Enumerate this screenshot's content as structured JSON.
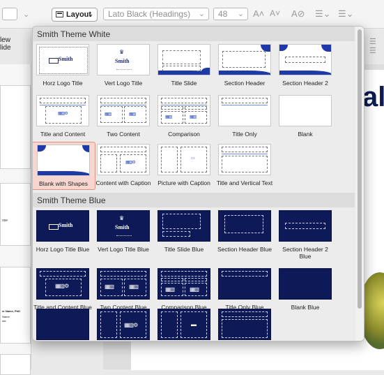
{
  "toolbar": {
    "font_name": "Lato Black (Headings)",
    "font_size": "48",
    "layout_label": "Layout",
    "new_slide_label": "New\nSlide"
  },
  "background": {
    "big_text": "al",
    "left_pane_texts": [
      "ose",
      "er Name, PhD",
      "Name",
      "ute"
    ]
  },
  "popup": {
    "sections": [
      {
        "name": "Smith Theme White",
        "layouts": [
          {
            "label": "Horz Logo Title",
            "icon": "horz-logo-title-thumb"
          },
          {
            "label": "Vert Logo Title",
            "icon": "vert-logo-title-thumb"
          },
          {
            "label": "Title Slide",
            "icon": "title-slide-thumb"
          },
          {
            "label": "Section Header",
            "icon": "section-header-thumb"
          },
          {
            "label": "Section Header 2",
            "icon": "section-header-2-thumb"
          },
          {
            "label": "Title and Content",
            "icon": "title-content-thumb"
          },
          {
            "label": "Two Content",
            "icon": "two-content-thumb"
          },
          {
            "label": "Comparison",
            "icon": "comparison-thumb"
          },
          {
            "label": "Title Only",
            "icon": "title-only-thumb"
          },
          {
            "label": "Blank",
            "icon": "blank-thumb"
          },
          {
            "label": "Blank with Shapes",
            "icon": "blank-shapes-thumb",
            "selected": true
          },
          {
            "label": "Content with Caption",
            "icon": "content-caption-thumb"
          },
          {
            "label": "Picture with Caption",
            "icon": "picture-caption-thumb"
          },
          {
            "label": "Title and Vertical Text",
            "icon": "title-vertical-text-thumb"
          }
        ]
      },
      {
        "name": "Smith Theme Blue",
        "layouts": [
          {
            "label": "Horz Logo Title Blue",
            "icon": "horz-logo-title-blue-thumb"
          },
          {
            "label": "Vert Logo Title Blue",
            "icon": "vert-logo-title-blue-thumb"
          },
          {
            "label": "Title Slide Blue",
            "icon": "title-slide-blue-thumb"
          },
          {
            "label": "Section Header Blue",
            "icon": "section-header-blue-thumb"
          },
          {
            "label": "Section Header 2 Blue",
            "icon": "section-header-2-blue-thumb"
          },
          {
            "label": "Title and Content Blue",
            "icon": "title-content-blue-thumb"
          },
          {
            "label": "Two Content Blue",
            "icon": "two-content-blue-thumb"
          },
          {
            "label": "Comparison Blue",
            "icon": "comparison-blue-thumb"
          },
          {
            "label": "Title Only Blue",
            "icon": "title-only-blue-thumb"
          },
          {
            "label": "Blank Blue",
            "icon": "blank-blue-thumb"
          }
        ]
      }
    ],
    "logo_text": "Smith",
    "colors": {
      "navy": "#0d1a57",
      "accent": "#1f3aa8",
      "selection": "#f6d6cf"
    }
  }
}
